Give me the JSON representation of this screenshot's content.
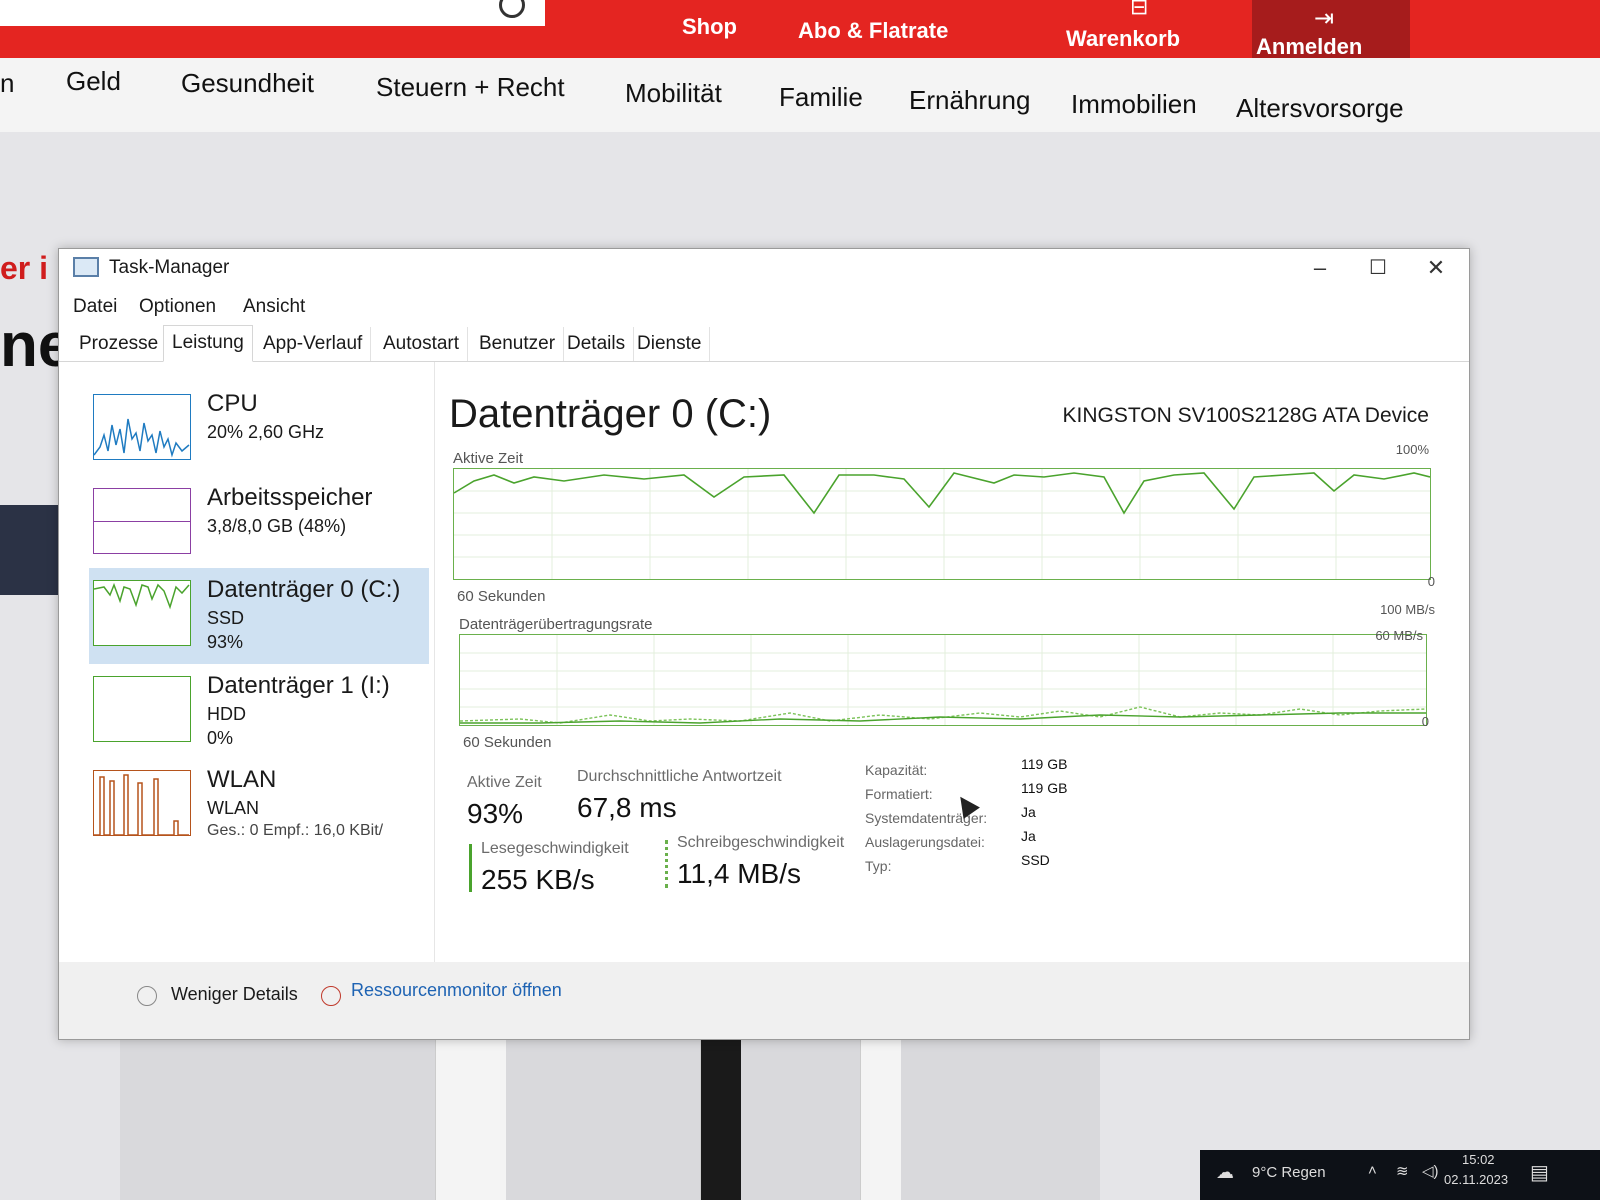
{
  "site": {
    "top_links": [
      "Shop",
      "Abo & Flatrate",
      "Warenkorb",
      "Anmelden"
    ],
    "nav": [
      "n",
      "Geld",
      "Gesundheit",
      "Steuern + Recht",
      "Mobilität",
      "Familie",
      "Ernährung",
      "Immobilien",
      "Altersvorsorge"
    ],
    "hero_text1": "er i",
    "hero_text2": "ne",
    "brand_color": "#e42521"
  },
  "window": {
    "title": "Task-Manager",
    "menu": [
      "Datei",
      "Optionen",
      "Ansicht"
    ],
    "tabs": [
      "Prozesse",
      "Leistung",
      "App-Verlauf",
      "Autostart",
      "Benutzer",
      "Details",
      "Dienste"
    ],
    "active_tab": "Leistung"
  },
  "resources": [
    {
      "name": "CPU",
      "sub1": "20% 2,60 GHz",
      "sub2": "",
      "color": "#1f7bc1"
    },
    {
      "name": "Arbeitsspeicher",
      "sub1": "3,8/8,0 GB (48%)",
      "sub2": "",
      "color": "#8b3fa3"
    },
    {
      "name": "Datenträger 0 (C:)",
      "sub1": "SSD",
      "sub2": "93%",
      "color": "#4aa32d"
    },
    {
      "name": "Datenträger 1 (I:)",
      "sub1": "HDD",
      "sub2": "0%",
      "color": "#4aa32d"
    },
    {
      "name": "WLAN",
      "sub1": "WLAN",
      "sub2": "Ges.: 0 Empf.: 16,0 KBit/",
      "color": "#b5531c"
    }
  ],
  "detail": {
    "title": "Datenträger 0 (C:)",
    "device": "KINGSTON SV100S2128G ATA Device",
    "graph1": {
      "label": "Aktive Zeit",
      "max": "100%",
      "min": "0",
      "time": "60 Sekunden"
    },
    "graph2": {
      "label": "Datenträgerübertragungsrate",
      "max": "100 MB/s",
      "mid": "60 MB/s",
      "min": "0",
      "time": "60 Sekunden"
    },
    "stats": {
      "active_label": "Aktive Zeit",
      "active_value": "93%",
      "resp_label": "Durchschnittliche Antwortzeit",
      "resp_value": "67,8 ms",
      "read_label": "Lesegeschwindigkeit",
      "read_value": "255 KB/s",
      "write_label": "Schreibgeschwindigkeit",
      "write_value": "11,4 MB/s"
    },
    "properties": [
      {
        "label": "Kapazität:",
        "value": "119 GB"
      },
      {
        "label": "Formatiert:",
        "value": "119 GB"
      },
      {
        "label": "Systemdatenträger:",
        "value": "Ja"
      },
      {
        "label": "Auslagerungsdatei:",
        "value": "Ja"
      },
      {
        "label": "Typ:",
        "value": "SSD"
      }
    ]
  },
  "footer": {
    "less_details": "Weniger Details",
    "resmon": "Ressourcenmonitor öffnen"
  },
  "taskbar": {
    "weather": "9°C  Regen",
    "time": "15:02",
    "date": "02.11.2023"
  }
}
